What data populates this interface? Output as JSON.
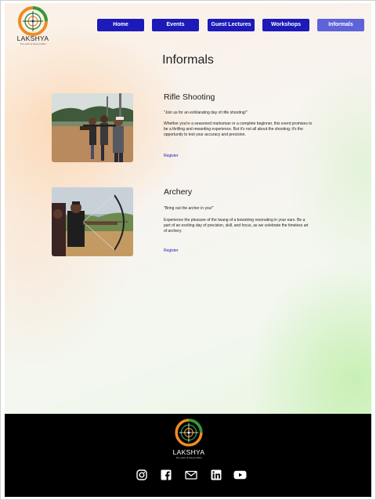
{
  "brand": {
    "name": "LAKSHYA",
    "tagline": "The spirit of being Indian",
    "colors": {
      "saffron": "#f08a24",
      "green": "#2e9b3a",
      "navy": "#1c1ab8"
    }
  },
  "nav": {
    "items": [
      {
        "label": "Home",
        "active": false
      },
      {
        "label": "Events",
        "active": false
      },
      {
        "label": "Guest Lectures",
        "active": false
      },
      {
        "label": "Workshops",
        "active": false
      },
      {
        "label": "Informals",
        "active": true
      }
    ]
  },
  "main": {
    "title": "Informals",
    "cards": [
      {
        "title": "Rifle Shooting",
        "quote": "\"Join us for an exhilarating day of rifle shooting!\"",
        "description": "Whether you're a seasoned marksman or a complete beginner, this event promises to be a thrilling and rewarding experience. But it's not all about the shooting; it's the opportunity to test your accuracy and precision.",
        "register_label": "Register",
        "image_icon": "rifle-shooting-photo"
      },
      {
        "title": "Archery",
        "quote": "\"Bring out the archer in you!\"",
        "description": "Experience the pleasure of the twang of a bowstring resonating in your ears. Be a part of an exciting day of precision, skill, and focus, as we celebrate the timeless art of archery.",
        "register_label": "Register",
        "image_icon": "archery-photo"
      }
    ]
  },
  "footer": {
    "brand_name": "LAKSHYA",
    "brand_tagline": "The spirit of being Indian",
    "social": [
      "instagram-icon",
      "facebook-icon",
      "mail-icon",
      "linkedin-icon",
      "youtube-icon"
    ]
  }
}
